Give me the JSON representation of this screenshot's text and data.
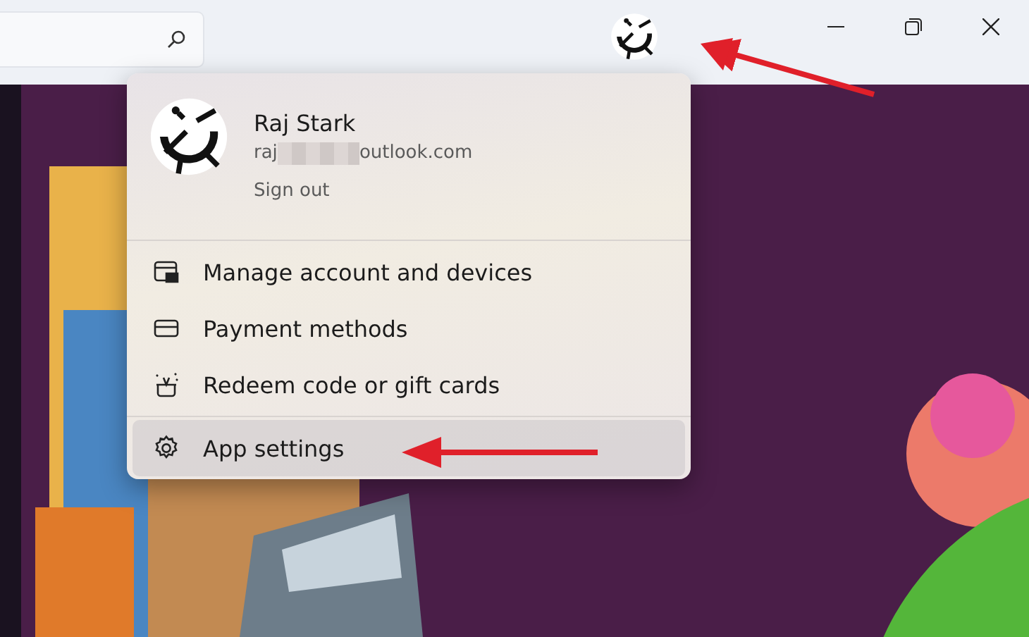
{
  "account_menu": {
    "name": "Raj Stark",
    "email_start": "raj",
    "email_end": "outlook.com",
    "sign_out": "Sign out",
    "groups": [
      [
        {
          "label": "Manage account and devices",
          "kind": "manage",
          "selected": false
        },
        {
          "label": "Payment methods",
          "kind": "card",
          "selected": false
        },
        {
          "label": "Redeem code or gift cards",
          "kind": "gift",
          "selected": false
        }
      ],
      [
        {
          "label": "App settings",
          "kind": "gear",
          "selected": true
        }
      ]
    ]
  }
}
